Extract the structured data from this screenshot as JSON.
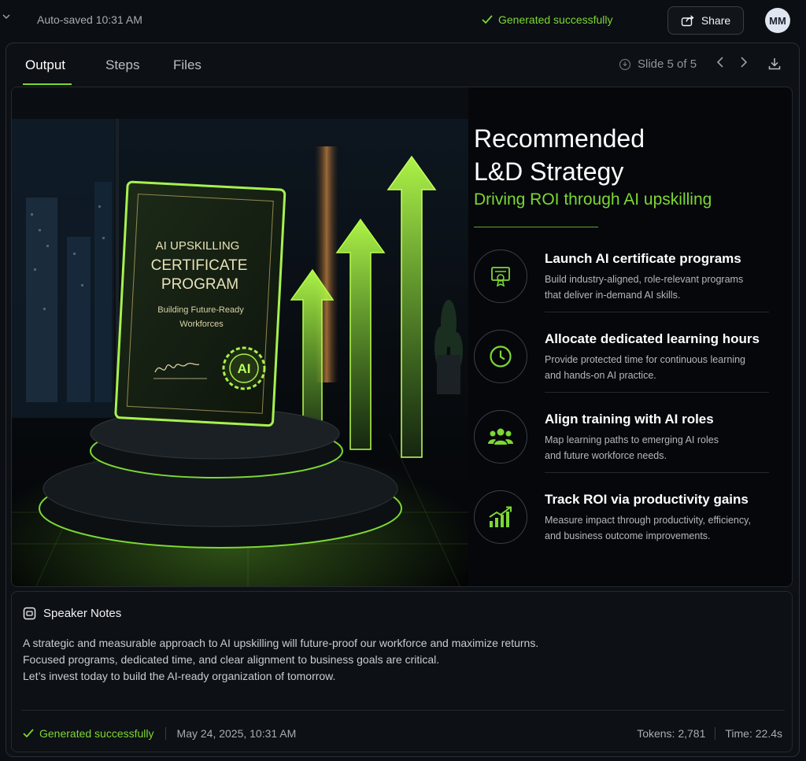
{
  "topbar": {
    "autosaved": "Auto-saved 10:31 AM",
    "status": "Generated successfully",
    "share_label": "Share",
    "avatar_initials": "MM"
  },
  "tabs": [
    {
      "label": "Output",
      "active": true
    },
    {
      "label": "Steps",
      "active": false
    },
    {
      "label": "Files",
      "active": false
    }
  ],
  "slide_nav": {
    "label": "Slide 5 of 5",
    "current": 5,
    "total": 5
  },
  "slide": {
    "title_line1": "Recommended",
    "title_line2": "L&D Strategy",
    "subtitle": "Driving ROI through AI upskilling",
    "certificate": {
      "line1": "AI UPSKILLING",
      "line2": "CERTIFICATE",
      "line3": "PROGRAM",
      "tagline1": "Building Future-Ready",
      "tagline2": "Workforces",
      "seal": "AI"
    },
    "items": [
      {
        "icon": "certificate-icon",
        "title": "Launch AI certificate programs",
        "desc_line1": "Build industry-aligned, role-relevant programs",
        "desc_line2": "that deliver in-demand AI skills."
      },
      {
        "icon": "clock-icon",
        "title": "Allocate dedicated learning hours",
        "desc_line1": "Provide protected time for continuous learning",
        "desc_line2": "and hands-on AI practice."
      },
      {
        "icon": "team-icon",
        "title": "Align training with AI roles",
        "desc_line1": "Map learning paths to emerging AI roles",
        "desc_line2": "and future workforce needs."
      },
      {
        "icon": "growth-chart-icon",
        "title": "Track ROI via productivity gains",
        "desc_line1": "Measure impact through productivity, efficiency,",
        "desc_line2": "and business outcome improvements."
      }
    ]
  },
  "notes": {
    "heading": "Speaker Notes",
    "lines": [
      "A strategic and measurable approach to AI upskilling will future-proof our workforce and maximize returns.",
      "Focused programs, dedicated time, and clear alignment to business goals are critical.",
      "Let’s invest today to build the AI-ready organization of tomorrow."
    ]
  },
  "footer": {
    "status": "Generated successfully",
    "date": "May 24, 2025, 10:31 AM",
    "tokens": "Tokens: 2,781",
    "time": "Time: 22.4s"
  },
  "colors": {
    "accent": "#7cd833",
    "background": "#0b0e12",
    "panel_border": "#2a2f36"
  }
}
